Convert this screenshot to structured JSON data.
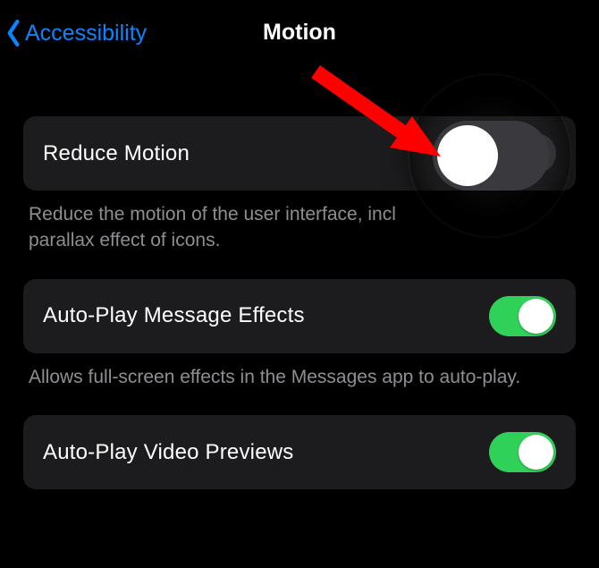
{
  "header": {
    "back_label": "Accessibility",
    "title": "Motion"
  },
  "items": [
    {
      "label": "Reduce Motion",
      "on": false,
      "desc_line1": "Reduce the motion of the user interface, incl",
      "desc_line2": "parallax effect of icons."
    },
    {
      "label": "Auto-Play Message Effects",
      "on": true,
      "desc": "Allows full-screen effects in the Messages app to auto-play."
    },
    {
      "label": "Auto-Play Video Previews",
      "on": true
    }
  ],
  "annotation": {
    "arrow_color": "#ff0000"
  }
}
